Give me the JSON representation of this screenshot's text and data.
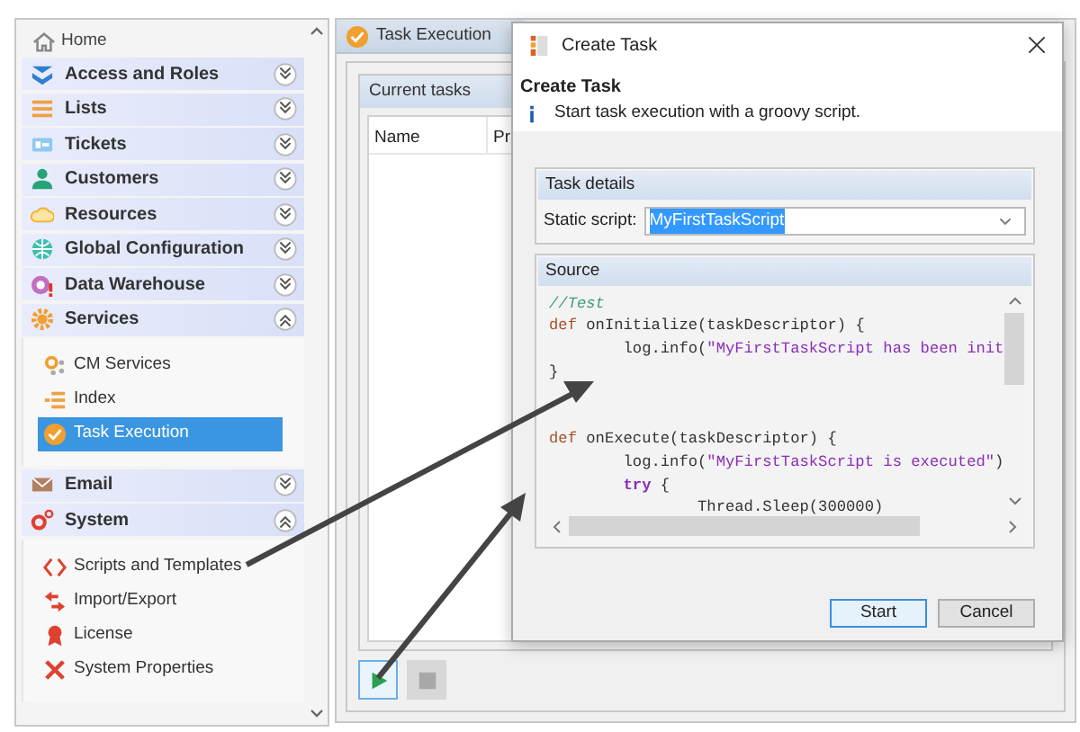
{
  "sidebar": {
    "home": {
      "label": "Home"
    },
    "sections": [
      {
        "label": "Access and Roles",
        "kind": "access",
        "expanded": false
      },
      {
        "label": "Lists",
        "kind": "lists",
        "expanded": false
      },
      {
        "label": "Tickets",
        "kind": "tickets",
        "expanded": false
      },
      {
        "label": "Customers",
        "kind": "customers",
        "expanded": false
      },
      {
        "label": "Resources",
        "kind": "resources",
        "expanded": false
      },
      {
        "label": "Global Configuration",
        "kind": "globe",
        "expanded": false
      },
      {
        "label": "Data Warehouse",
        "kind": "warehouse",
        "expanded": false
      },
      {
        "label": "Services",
        "kind": "services",
        "expanded": true,
        "children": [
          {
            "label": "CM Services",
            "kind": "cm",
            "selected": false
          },
          {
            "label": "Index",
            "kind": "index",
            "selected": false
          },
          {
            "label": "Task Execution",
            "kind": "task",
            "selected": true
          }
        ]
      },
      {
        "label": "Email",
        "kind": "email",
        "expanded": false
      },
      {
        "label": "System",
        "kind": "system",
        "expanded": true,
        "children": [
          {
            "label": "Scripts and Templates",
            "kind": "scripts",
            "selected": false
          },
          {
            "label": "Import/Export",
            "kind": "import",
            "selected": false
          },
          {
            "label": "License",
            "kind": "license",
            "selected": false
          },
          {
            "label": "System Properties",
            "kind": "properties",
            "selected": false
          }
        ]
      }
    ]
  },
  "main": {
    "tab": {
      "label": "Task Execution"
    },
    "panel": {
      "title": "Current tasks",
      "columns": [
        "Name",
        "Pr"
      ]
    },
    "toolbar": {
      "play": {
        "highlighted": true
      },
      "stop": {
        "disabled": true
      }
    }
  },
  "dialog": {
    "title": "Create Task",
    "heading": "Create Task",
    "description": "Start task execution with a groovy script.",
    "task_details": {
      "title": "Task details",
      "static_script": {
        "label": "Static script:",
        "value": "MyFirstTaskScript",
        "text_selected": true
      }
    },
    "source": {
      "title": "Source",
      "lines": [
        {
          "spaced": false,
          "tokens": [
            {
              "kind": "comment",
              "text": "//Test"
            }
          ]
        },
        {
          "spaced": false,
          "tokens": [
            {
              "kind": "keyword",
              "text": "def"
            },
            {
              "kind": "plain",
              "text": " onInitialize(taskDescriptor) {"
            }
          ]
        },
        {
          "spaced": false,
          "tokens": [
            {
              "kind": "plain",
              "text": "        log.info("
            },
            {
              "kind": "string",
              "text": "\"MyFirstTaskScript has been init"
            }
          ]
        },
        {
          "spaced": false,
          "tokens": [
            {
              "kind": "plain",
              "text": "}"
            }
          ]
        },
        {
          "spaced": true,
          "tokens": [
            {
              "kind": "keyword",
              "text": "def"
            },
            {
              "kind": "plain",
              "text": " onExecute(taskDescriptor) {"
            }
          ]
        },
        {
          "spaced": false,
          "tokens": [
            {
              "kind": "plain",
              "text": "        log.info("
            },
            {
              "kind": "string",
              "text": "\"MyFirstTaskScript is executed\""
            },
            {
              "kind": "plain",
              "text": ")"
            }
          ]
        },
        {
          "spaced": false,
          "tokens": [
            {
              "kind": "control",
              "text": "        try"
            },
            {
              "kind": "plain",
              "text": " {"
            }
          ]
        },
        {
          "spaced": false,
          "tokens": [
            {
              "kind": "plain",
              "text": "                Thread.Sleep(300000)"
            }
          ]
        }
      ]
    },
    "buttons": [
      {
        "label": "Start",
        "default": true
      },
      {
        "label": "Cancel",
        "default": false
      }
    ]
  }
}
